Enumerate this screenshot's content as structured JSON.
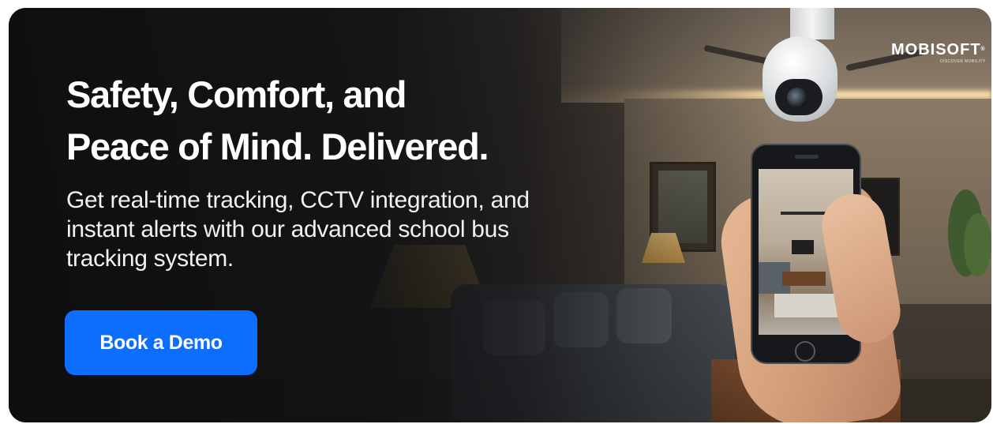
{
  "logo": {
    "wordmark": "MOBISOFT",
    "trademark": "®",
    "tagline": "DISCOVER MOBILITY"
  },
  "hero": {
    "headline_line1": "Safety, Comfort, and",
    "headline_line2": "Peace of Mind. Delivered.",
    "subtext_line1": "Get real-time tracking, CCTV integration, and",
    "subtext_line2": "instant alerts with our advanced school bus",
    "subtext_line3": "tracking system."
  },
  "cta": {
    "label": "Book a Demo"
  },
  "colors": {
    "cta_background": "#0d6efd",
    "text": "#ffffff"
  },
  "icons": [
    "cctv-camera-icon",
    "smartphone-icon"
  ]
}
